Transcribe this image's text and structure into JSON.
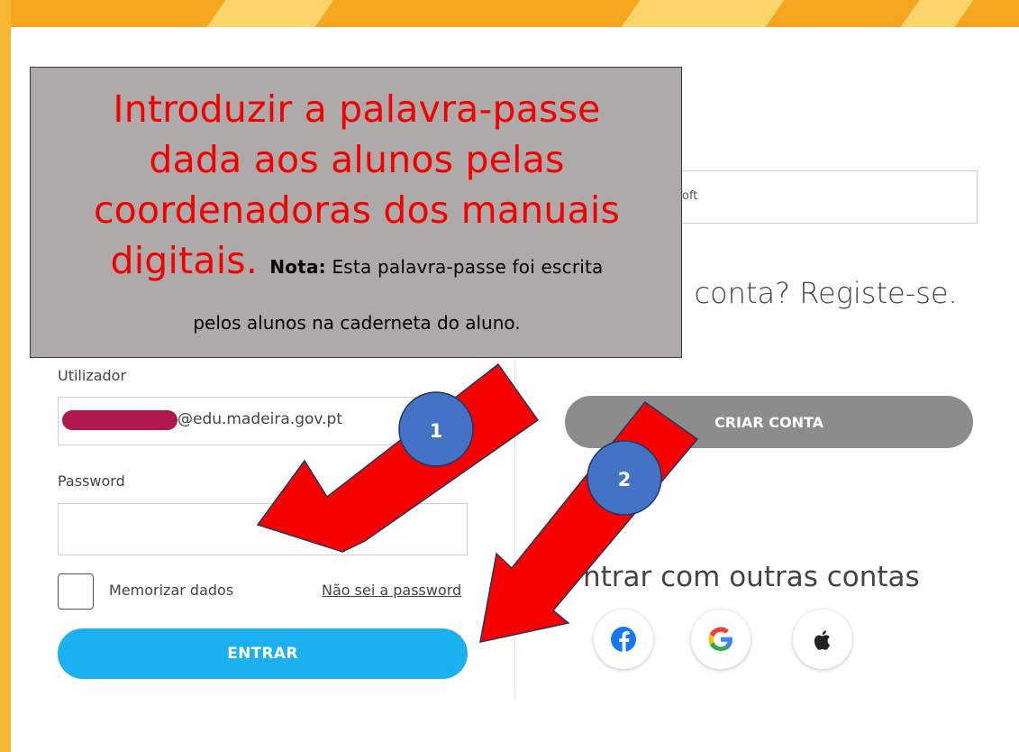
{
  "annotation": {
    "line1": "Introduzir a palavra-passe",
    "line2": "dada aos alunos pelas",
    "line3": "coordenadoras dos manuais",
    "line4_big": "digitais.",
    "note_label": "Nota:",
    "note_text": "Esta palavra-passe foi escrita",
    "note_text_2": "pelos alunos na caderneta do aluno."
  },
  "login": {
    "user_label": "Utilizador",
    "user_value": "@edu.madeira.gov.pt",
    "password_label": "Password",
    "password_value": "",
    "remember_label": "Memorizar dados",
    "forgot_link": "Não sei a password",
    "submit_label": "ENTRAR"
  },
  "right": {
    "ms_field_text": "oft",
    "register_text": "n conta? Registe-se.",
    "create_button": "CRIAR CONTA",
    "other_accounts": "ntrar com outras contas",
    "social_icons": [
      "facebook-icon",
      "google-icon",
      "apple-icon"
    ]
  },
  "markers": {
    "badge_1": "1",
    "badge_2": "2"
  },
  "colors": {
    "arrow": "#f70000",
    "badge": "#4472c4",
    "primary_button": "#1bb0ef",
    "secondary_button": "#8c8c8c",
    "banner": "#f5a51e",
    "annotation_text": "#f20000",
    "redaction": "#b0174d"
  }
}
